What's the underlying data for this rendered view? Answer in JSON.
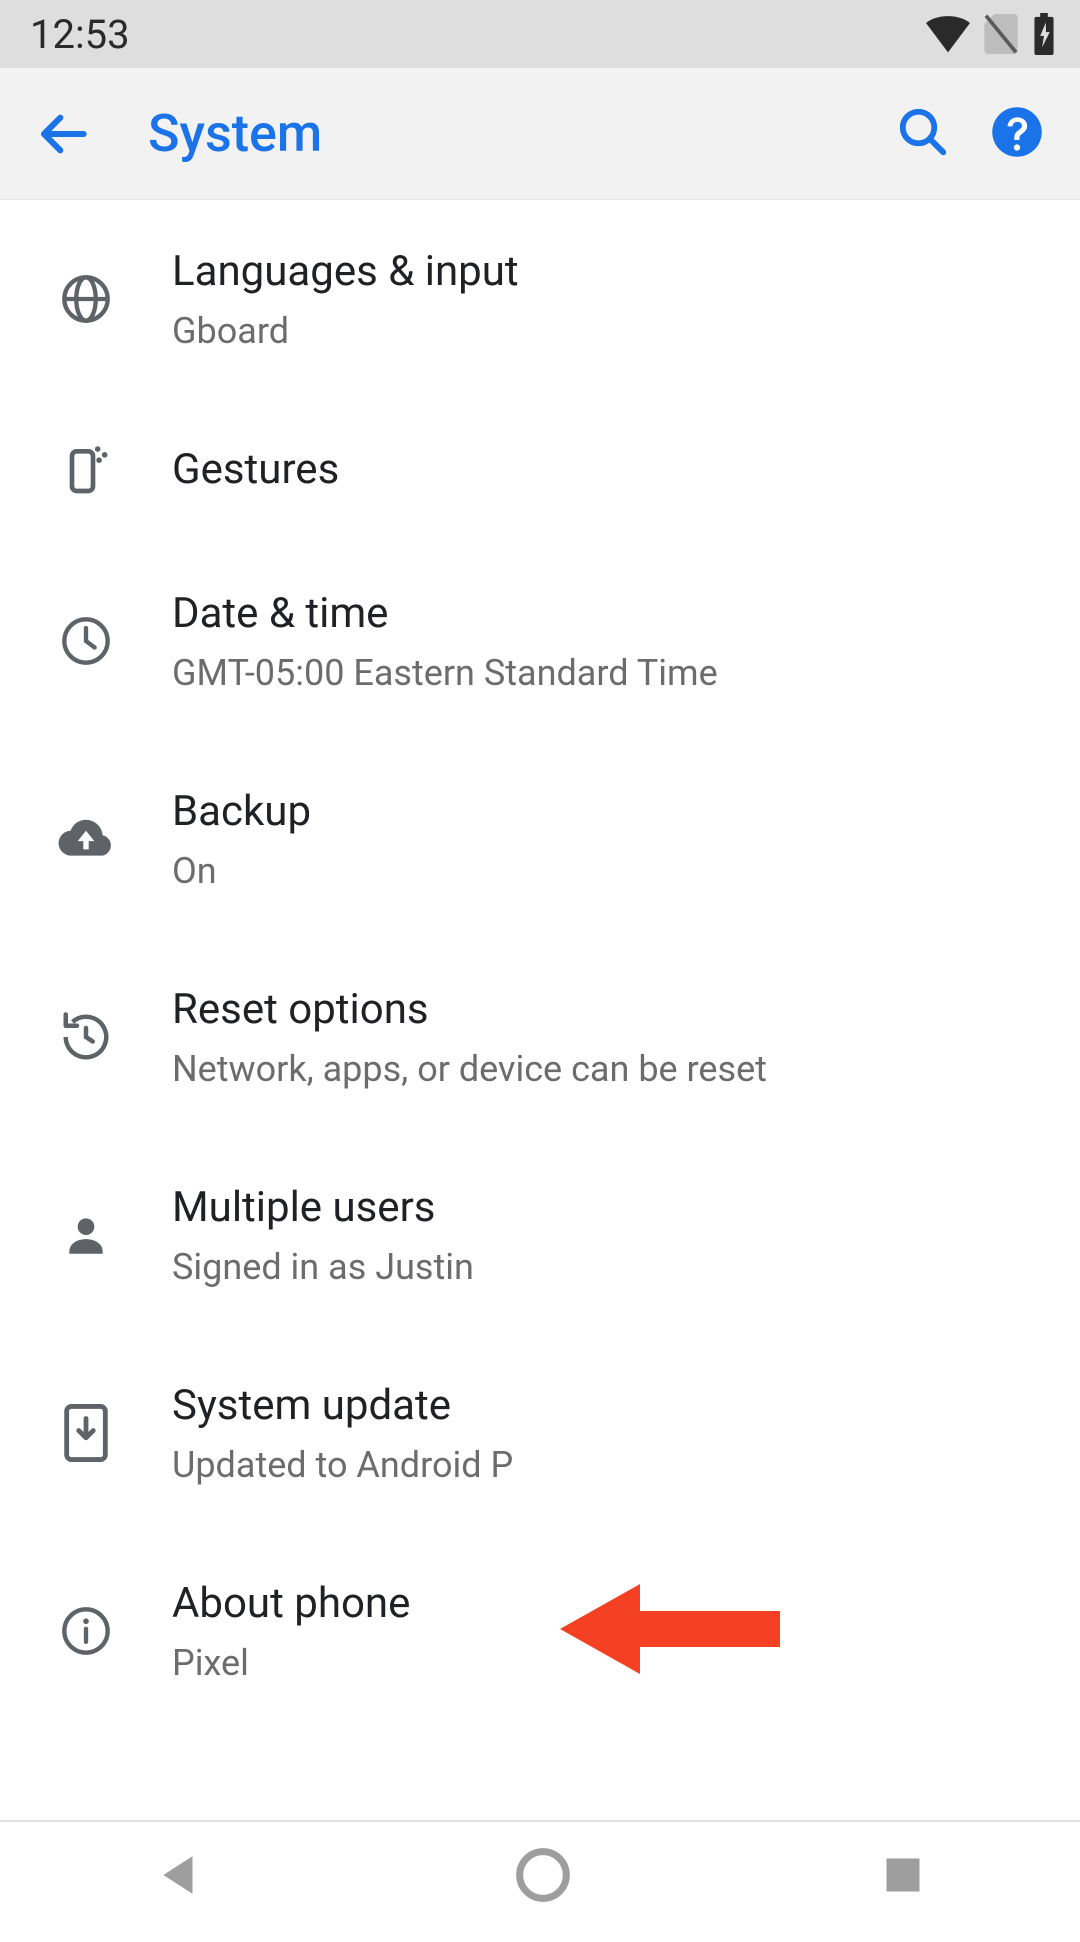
{
  "statusbar": {
    "time": "12:53"
  },
  "appbar": {
    "title": "System"
  },
  "items": [
    {
      "icon": "globe",
      "title": "Languages & input",
      "subtitle": "Gboard"
    },
    {
      "icon": "gesture",
      "title": "Gestures",
      "subtitle": ""
    },
    {
      "icon": "clock",
      "title": "Date & time",
      "subtitle": "GMT-05:00 Eastern Standard Time"
    },
    {
      "icon": "cloudup",
      "title": "Backup",
      "subtitle": "On"
    },
    {
      "icon": "restore",
      "title": "Reset options",
      "subtitle": "Network, apps, or device can be reset"
    },
    {
      "icon": "person",
      "title": "Multiple users",
      "subtitle": "Signed in as Justin"
    },
    {
      "icon": "sysupd",
      "title": "System update",
      "subtitle": "Updated to Android P"
    },
    {
      "icon": "info",
      "title": "About phone",
      "subtitle": "Pixel",
      "annotated": true
    }
  ],
  "colors": {
    "accent": "#1a73e8",
    "annotation": "#f54123"
  }
}
